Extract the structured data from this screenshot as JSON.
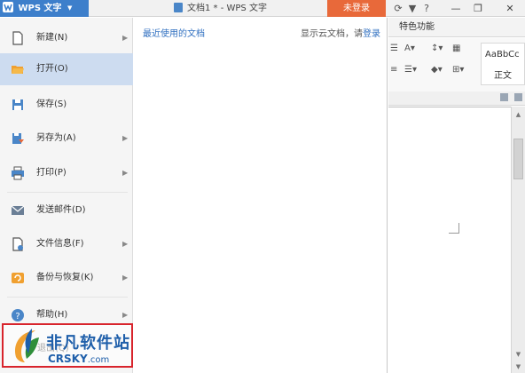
{
  "titlebar": {
    "app_name": "WPS 文字",
    "doc_title": "文档1 * - WPS 文字",
    "login_button": "未登录",
    "icons": [
      "refresh-icon",
      "skin-icon",
      "help-icon",
      "minimize-ribbon-icon"
    ],
    "help_label": "?"
  },
  "window_controls": [
    "minimize",
    "restore",
    "close"
  ],
  "menu": {
    "items": [
      {
        "label": "新建(N)",
        "icon": "new-document-icon",
        "has_submenu": true
      },
      {
        "label": "打开(O)",
        "icon": "folder-open-icon",
        "has_submenu": false,
        "active": true
      },
      {
        "label": "保存(S)",
        "icon": "save-icon",
        "has_submenu": false
      },
      {
        "label": "另存为(A)",
        "icon": "save-as-icon",
        "has_submenu": true
      },
      {
        "label": "打印(P)",
        "icon": "printer-icon",
        "has_submenu": true
      },
      {
        "label": "发送邮件(D)",
        "icon": "email-icon",
        "has_submenu": false
      },
      {
        "label": "文件信息(F)",
        "icon": "file-info-icon",
        "has_submenu": true
      },
      {
        "label": "备份与恢复(K)",
        "icon": "backup-icon",
        "has_submenu": true
      },
      {
        "label": "帮助(H)",
        "icon": "help-icon",
        "has_submenu": true
      }
    ],
    "exit_label": "退出(Q)"
  },
  "recent": {
    "title": "最近使用的文档",
    "cloud_text": "显示云文档，请",
    "cloud_login": "登录"
  },
  "ribbon": {
    "tab": "特色功能",
    "style_sample": "AaBbCc",
    "style_name": "正文"
  },
  "watermark": {
    "cn": "非凡软件站",
    "en": "CRSKY",
    "domain": ".com"
  },
  "colors": {
    "app_blue": "#3d7fcb",
    "login_orange": "#e8693a",
    "active_item": "#cddcf0",
    "link_blue": "#2f6fc0",
    "watermark_red": "#d8242c"
  }
}
